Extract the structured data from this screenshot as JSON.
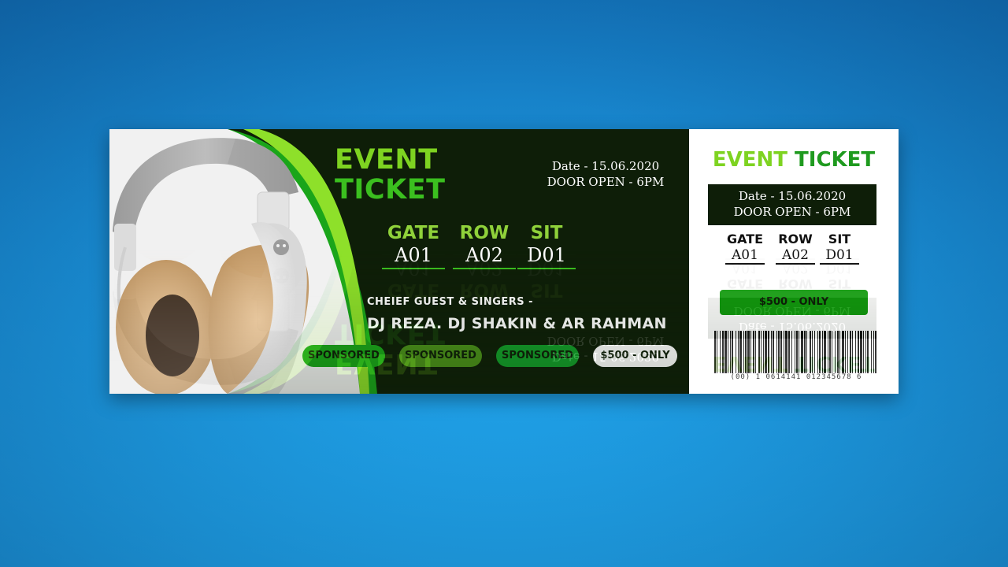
{
  "ticket": {
    "title_line1": "EVENT",
    "title_line2": "TICKET",
    "date": "Date - 15.06.2020",
    "door_open": "DOOR OPEN - 6PM",
    "gate_label": "GATE",
    "gate_value": "A01",
    "row_label": "ROW",
    "row_value": "A02",
    "sit_label": "SIT",
    "sit_value": "D01",
    "guest_label": "CHEIEF GUEST & SINGERS -",
    "guest_names": "DJ REZA. DJ SHAKIN & AR RAHMAN",
    "sponsors": [
      "SPONSORED",
      "SPONSORED",
      "SPONSORED"
    ],
    "price": "$500 - ONLY"
  },
  "stub": {
    "title_part1": "EVENT",
    "title_part2": "TICKET",
    "date": "Date - 15.06.2020",
    "door_open": "DOOR OPEN - 6PM",
    "gate_label": "GATE",
    "gate_value": "A01",
    "row_label": "ROW",
    "row_value": "A02",
    "sit_label": "SIT",
    "sit_value": "D01",
    "price": "$500 - ONLY",
    "barcode_digits": "(00) 1 0614141 012345678 6"
  },
  "colors": {
    "dark_bg": "#0e1e08",
    "lime": "#7ed321",
    "green": "#3bbf1f",
    "dark_green": "#129a0e",
    "sponsor_1": "#1aa51a",
    "sponsor_2": "#4a8f1a",
    "sponsor_3": "#139c2a"
  },
  "image": {
    "subject": "headphones-image"
  }
}
